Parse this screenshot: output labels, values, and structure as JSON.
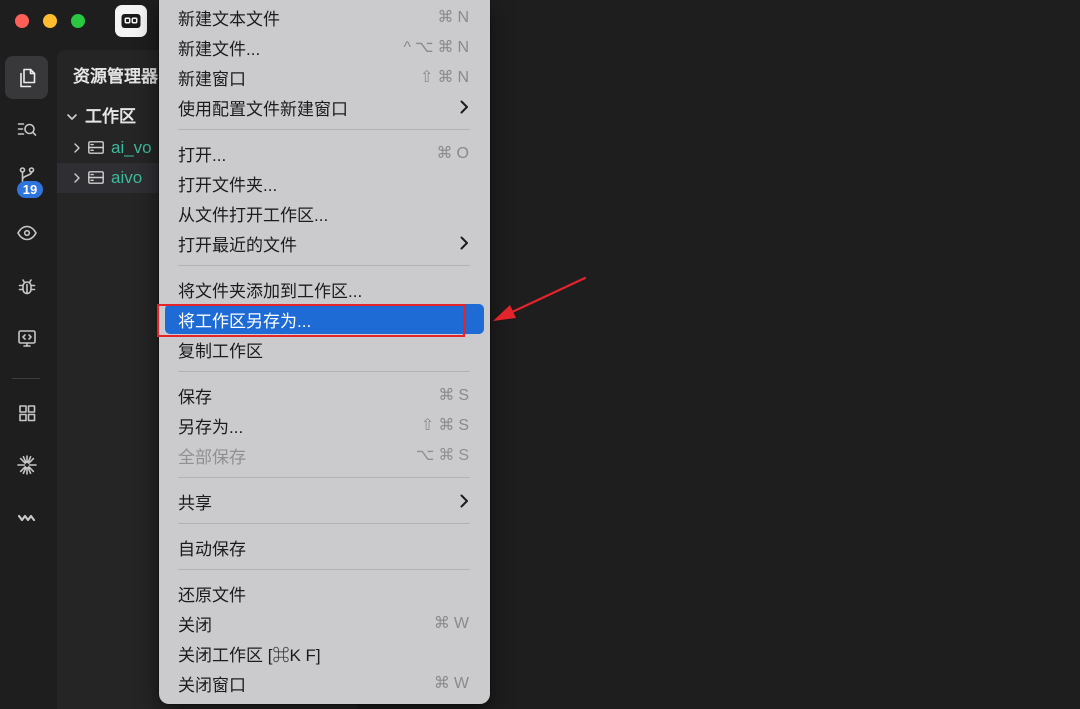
{
  "colors": {
    "editor_bg": "#1e1e1e",
    "sidebar_bg": "#252526",
    "menu_bg": "#cbcbcd",
    "menu_hl": "#1f6bd6",
    "folder": "#3dba9b",
    "badge": "#2f73dc",
    "annot": "#e5232b",
    "close_light": "#ff5f57",
    "minimize_light": "#febc2e",
    "zoom_light": "#28c840"
  },
  "title_bar": {
    "app_icon": "app-icon"
  },
  "activity_bar": {
    "items": [
      {
        "icon": "files-icon",
        "active": true
      },
      {
        "icon": "search-icon",
        "active": false
      },
      {
        "icon": "source-control-icon",
        "active": false,
        "badge": "19"
      },
      {
        "icon": "eye-icon",
        "active": false
      },
      {
        "icon": "bug-icon",
        "active": false
      },
      {
        "icon": "remote-explorer-icon",
        "active": false
      },
      {
        "icon": "extensions-icon",
        "active": false
      },
      {
        "icon": "sparkle-icon",
        "active": false
      },
      {
        "icon": "wave-icon",
        "active": false
      }
    ]
  },
  "sidebar": {
    "title": "资源管理器",
    "workspace": {
      "label": "工作区",
      "expanded": true,
      "folders": [
        {
          "label": "ai_vo",
          "icon": "root-folder-icon",
          "expanded": false,
          "selected": false
        },
        {
          "label": "aivo",
          "icon": "root-folder-icon",
          "expanded": false,
          "selected": true
        }
      ]
    }
  },
  "file_menu": {
    "submenu_icon": "chevron-right-icon",
    "groups": [
      {
        "items": [
          {
            "label": "新建文本文件",
            "shortcut": "⌘N"
          },
          {
            "label": "新建文件...",
            "shortcut": "^⌥⌘N"
          },
          {
            "label": "新建窗口",
            "shortcut": "⇧⌘N"
          },
          {
            "label": "使用配置文件新建窗口",
            "submenu": true
          }
        ]
      },
      {
        "items": [
          {
            "label": "打开...",
            "shortcut": "⌘O"
          },
          {
            "label": "打开文件夹..."
          },
          {
            "label": "从文件打开工作区..."
          },
          {
            "label": "打开最近的文件",
            "submenu": true
          }
        ]
      },
      {
        "items": [
          {
            "label": "将文件夹添加到工作区..."
          },
          {
            "label": "将工作区另存为...",
            "highlighted": true
          },
          {
            "label": "复制工作区"
          }
        ]
      },
      {
        "items": [
          {
            "label": "保存",
            "shortcut": "⌘S"
          },
          {
            "label": "另存为...",
            "shortcut": "⇧⌘S"
          },
          {
            "label": "全部保存",
            "shortcut": "⌥⌘S",
            "disabled": true
          }
        ]
      },
      {
        "items": [
          {
            "label": "共享",
            "submenu": true
          }
        ]
      },
      {
        "items": [
          {
            "label": "自动保存"
          }
        ]
      },
      {
        "items": [
          {
            "label": "还原文件"
          },
          {
            "label": "关闭",
            "shortcut": "⌘W"
          },
          {
            "label": "关闭工作区 [⌘K F]"
          },
          {
            "label": "关闭窗口",
            "shortcut": "⌘W"
          }
        ]
      }
    ]
  }
}
